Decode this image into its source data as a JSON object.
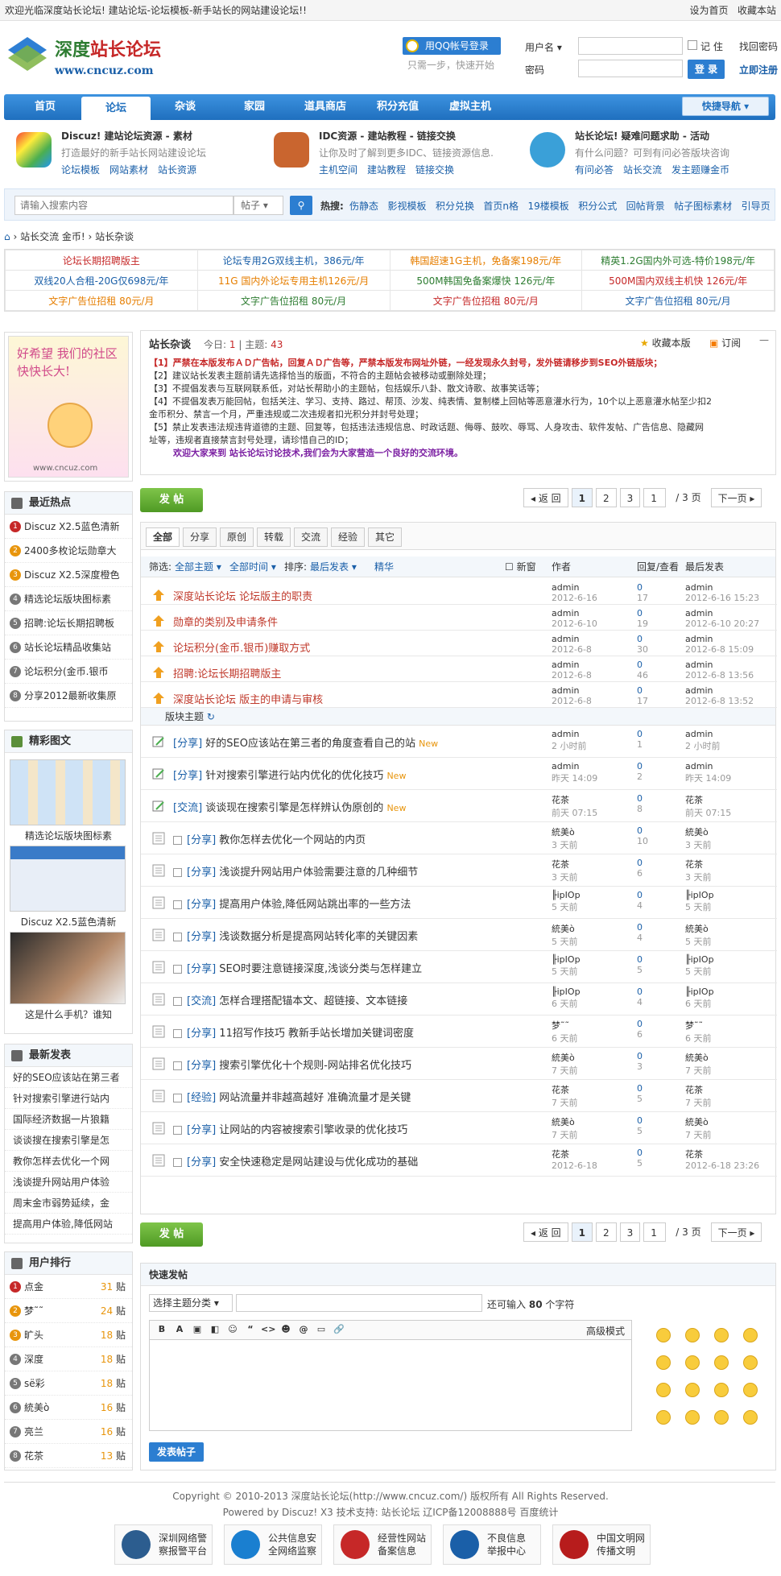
{
  "topbar": {
    "welcome": "欢迎光临深度站长论坛! 建站论坛-论坛模板-新手站长的网站建设论坛!!",
    "set_home": "设为首页",
    "bookmark": "收藏本站"
  },
  "logo": {
    "cn_a": "深度",
    "cn_b": "站长论坛",
    "url": "www.cncuz.com"
  },
  "login": {
    "qq_btn": "用QQ帐号登录",
    "qq_sub": "只需一步，快速开始",
    "username_label": "用户名",
    "password_label": "密码",
    "remember": "记 住",
    "forgot": "找回密码",
    "login_btn": "登 录",
    "register": "立即注册"
  },
  "nav": {
    "items": [
      "首页",
      "论坛",
      "杂谈",
      "家园",
      "道具商店",
      "积分充值",
      "虚拟主机"
    ],
    "quick": "快捷导航"
  },
  "features": [
    {
      "title": "Discuz! 建站论坛资源 - 素材",
      "desc": "打造最好的新手站长网站建设论坛",
      "links": "论坛模板　网站素材　站长资源"
    },
    {
      "title": "IDC资源 - 建站教程 - 链接交换",
      "desc": "让你及时了解到更多IDC、链接资源信息.",
      "links": "主机空间　建站教程　链接交换"
    },
    {
      "title": "站长论坛! 疑难问题求助 - 活动",
      "desc": "有什么问题？可到有问必答版块咨询",
      "links": "有问必答　站长交流　发主题赚金币"
    }
  ],
  "search": {
    "placeholder": "请输入搜索内容",
    "type": "帖子",
    "hot_label": "热搜:",
    "hot": [
      "伤静态",
      "影视模板",
      "积分兑换",
      "首页n格",
      "19楼模板",
      "积分公式",
      "回帖背景",
      "帖子图标素材",
      "引导页"
    ]
  },
  "breadcrumb": {
    "a": "站长交流 金币!",
    "b": "站长杂谈"
  },
  "ads": [
    [
      "论坛长期招聘版主",
      "论坛专用2G双线主机，386元/年",
      "韩国超速1G主机，免备案198元/年",
      "精英1.2G国内外可选-特价198元/年"
    ],
    [
      "双线20人合租-20G仅698元/年",
      "11G 国内外论坛专用主机126元/月",
      "500M韩国免备案爆快 126元/年",
      "500M国内双线主机快 126元/年"
    ],
    [
      "文字广告位招租 80元/月",
      "文字广告位招租 80元/月",
      "文字广告位招租 80元/月",
      "文字广告位招租 80元/月"
    ]
  ],
  "ad_colors": [
    "#c62828",
    "#1a5fa8",
    "#e67e00",
    "#2e7d32"
  ],
  "side": {
    "banner_text": "好希望 我们的社区 快快长大!",
    "banner_url": "www.cncuz.com",
    "hot_title": "最近热点",
    "hot": [
      "Discuz X2.5蓝色清新",
      "2400多枚论坛勋章大",
      "Discuz X2.5深度橙色",
      "精选论坛版块图标素",
      "招聘:论坛长期招聘板",
      "站长论坛精品收集站",
      "论坛积分(金币.银币",
      "分享2012最新收集原"
    ],
    "pic_title": "精彩图文",
    "pics": [
      "精选论坛版块图标素",
      "Discuz X2.5蓝色清新",
      "这是什么手机？谁知"
    ],
    "new_title": "最新发表",
    "new": [
      "好的SEO应该站在第三者",
      "针对搜索引擎进行站内",
      "国际经济数据一片狼籍",
      "谈谈搜在搜索引擎是怎",
      "教你怎样去优化一个网",
      "浅谈提升网站用户体验",
      "周末金市弱势延续，金",
      "提高用户体验,降低网站"
    ],
    "rank_title": "用户排行",
    "rank": [
      [
        "点金",
        "31"
      ],
      [
        "梦˜˜",
        "24"
      ],
      [
        "旷头",
        "18"
      ],
      [
        "深度",
        "18"
      ],
      [
        "sё彩",
        "18"
      ],
      [
        "統美ò",
        "16"
      ],
      [
        "亮兰",
        "16"
      ],
      [
        "花茶",
        "13"
      ]
    ],
    "rank_unit": "贴"
  },
  "forum": {
    "name": "站长杂谈",
    "today_label": "今日:",
    "today": "1",
    "topics_label": "主题:",
    "topics": "43",
    "fav": "收藏本版",
    "rss": "订阅",
    "rules": [
      "【1】严禁在本版发布ＡＤ广告帖，回复ＡＤ广告等，严禁本版发布网址外链，一经发现永久封号，发外链请移步到SEO外链版块；",
      "【2】建议站长发表主题前请先选择恰当的版面，不符合的主题帖会被移动或删除处理；",
      "【3】不提倡发表与互联网联系低，对站长帮助小的主题帖，包括娱乐八卦、散文诗歌、故事笑话等；",
      "【4】不提倡发表万能回帖，包括关注、学习、支持、路过、帮顶、沙发、纯表情、复制楼上回帖等恶意灌水行为，10个以上恶意灌水帖至少扣2",
      "金币积分、禁言一个月，严重违规或二次违规者扣光积分并封号处理；",
      "【5】禁止发表违法规违背道德的主题、回复等，包括违法违规信息、时政话题、侮辱、鼓吹、辱骂、人身攻击、软件发帖、广告信息、隐藏网",
      "址等，违规者直接禁言封号处理，请珍惜自己的ID；"
    ],
    "welcome": "欢迎大家来到 站长论坛讨论技术,我们会为大家营造一个良好的交流环境。"
  },
  "post_btn": "发 帖",
  "pager": {
    "back": "◂ 返 回",
    "p1": "1",
    "p2": "2",
    "p3": "3",
    "cur": "1",
    "total": "/ 3 页",
    "next": "下一页 ▸"
  },
  "tabs": [
    "全部",
    "分享",
    "原创",
    "转载",
    "交流",
    "经验",
    "其它"
  ],
  "filter": {
    "label": "筛选:",
    "all": "全部主题",
    "time": "全部时间",
    "sort_label": "排序:",
    "sort": "最后发表",
    "digest": "精华",
    "new_win": "新窗",
    "col_author": "作者",
    "col_reply": "回复/查看",
    "col_last": "最后发表"
  },
  "sticky_label": "版块主题",
  "threads": [
    {
      "type": "sticky",
      "tag": "",
      "title": "深度站长论坛 论坛版主的职责",
      "author": "admin",
      "date": "2012-6-16",
      "r": "0",
      "v": "17",
      "lu": "admin",
      "ld": "2012-6-16 15:23"
    },
    {
      "type": "sticky",
      "tag": "",
      "title": "勋章的类别及申请条件",
      "author": "admin",
      "date": "2012-6-10",
      "r": "0",
      "v": "19",
      "lu": "admin",
      "ld": "2012-6-10 20:27"
    },
    {
      "type": "sticky",
      "tag": "",
      "title": "论坛积分(金币.银币)赚取方式",
      "author": "admin",
      "date": "2012-6-8",
      "r": "0",
      "v": "30",
      "lu": "admin",
      "ld": "2012-6-8 15:09"
    },
    {
      "type": "sticky",
      "tag": "",
      "title": "招聘:论坛长期招聘版主",
      "author": "admin",
      "date": "2012-6-8",
      "r": "0",
      "v": "46",
      "lu": "admin",
      "ld": "2012-6-8 13:56"
    },
    {
      "type": "sticky",
      "tag": "",
      "title": "深度站长论坛 版主的申请与审核",
      "author": "admin",
      "date": "2012-6-8",
      "r": "0",
      "v": "17",
      "lu": "admin",
      "ld": "2012-6-8 13:52"
    },
    {
      "type": "new",
      "tag": "[分享]",
      "title": "好的SEO应该站在第三者的角度查看自己的站",
      "author": "admin",
      "date": "2 小时前",
      "r": "0",
      "v": "1",
      "lu": "admin",
      "ld": "2 小时前"
    },
    {
      "type": "new",
      "tag": "[分享]",
      "title": "针对搜索引擎进行站内优化的优化技巧",
      "author": "admin",
      "date": "昨天 14:09",
      "r": "0",
      "v": "2",
      "lu": "admin",
      "ld": "昨天 14:09"
    },
    {
      "type": "new",
      "tag": "[交流]",
      "title": "谈谈现在搜索引擎是怎样辨认伪原创的",
      "author": "花茶",
      "date": "前天 07:15",
      "r": "0",
      "v": "8",
      "lu": "花茶",
      "ld": "前天 07:15"
    },
    {
      "type": "normal",
      "tag": "[分享]",
      "title": "教你怎样去优化一个网站的内页",
      "author": "統美ò",
      "date": "3 天前",
      "r": "0",
      "v": "10",
      "lu": "統美ò",
      "ld": "3 天前"
    },
    {
      "type": "normal",
      "tag": "[分享]",
      "title": "浅谈提升网站用户体验需要注意的几种细节",
      "author": "花茶",
      "date": "3 天前",
      "r": "0",
      "v": "6",
      "lu": "花茶",
      "ld": "3 天前"
    },
    {
      "type": "normal",
      "tag": "[分享]",
      "title": "提高用户体验,降低网站跳出率的一些方法",
      "author": "╟ipIOp",
      "date": "5 天前",
      "r": "0",
      "v": "4",
      "lu": "╟ipIOp",
      "ld": "5 天前"
    },
    {
      "type": "normal",
      "tag": "[分享]",
      "title": "浅谈数据分析是提高网站转化率的关键因素",
      "author": "統美ò",
      "date": "5 天前",
      "r": "0",
      "v": "4",
      "lu": "統美ò",
      "ld": "5 天前"
    },
    {
      "type": "normal",
      "tag": "[分享]",
      "title": "SEO时要注意链接深度,浅谈分类与怎样建立",
      "author": "╟ipIOp",
      "date": "5 天前",
      "r": "0",
      "v": "5",
      "lu": "╟ipIOp",
      "ld": "5 天前"
    },
    {
      "type": "normal",
      "tag": "[交流]",
      "title": "怎样合理搭配锚本文、超链接、文本链接",
      "author": "╟ipIOp",
      "date": "6 天前",
      "r": "0",
      "v": "4",
      "lu": "╟ipIOp",
      "ld": "6 天前"
    },
    {
      "type": "normal",
      "tag": "[分享]",
      "title": "11招写作技巧 教新手站长增加关键词密度",
      "author": "梦˜˜",
      "date": "6 天前",
      "r": "0",
      "v": "6",
      "lu": "梦˜˜",
      "ld": "6 天前"
    },
    {
      "type": "normal",
      "tag": "[分享]",
      "title": "搜索引擎优化十个规则-网站排名优化技巧",
      "author": "統美ò",
      "date": "7 天前",
      "r": "0",
      "v": "3",
      "lu": "統美ò",
      "ld": "7 天前"
    },
    {
      "type": "normal",
      "tag": "[经验]",
      "title": "网站流量并非越高越好 准确流量才是关键",
      "author": "花茶",
      "date": "7 天前",
      "r": "0",
      "v": "5",
      "lu": "花茶",
      "ld": "7 天前"
    },
    {
      "type": "normal",
      "tag": "[分享]",
      "title": "让网站的内容被搜索引擎收录的优化技巧",
      "author": "統美ò",
      "date": "7 天前",
      "r": "0",
      "v": "5",
      "lu": "統美ò",
      "ld": "7 天前"
    },
    {
      "type": "normal",
      "tag": "[分享]",
      "title": "安全快速稳定是网站建设与优化成功的基础",
      "author": "花茶",
      "date": "2012-6-18",
      "r": "0",
      "v": "5",
      "lu": "花茶",
      "ld": "2012-6-18 23:26"
    }
  ],
  "quick": {
    "title": "快速发帖",
    "cat": "选择主题分类",
    "remain": "还可输入",
    "count": "80",
    "unit": "个字符",
    "adv": "高级模式",
    "submit": "发表帖子",
    "tools": [
      "B",
      "A",
      "▣",
      "◧",
      "☺",
      "“",
      "<>",
      "☻",
      "@",
      "▭",
      "🔗"
    ]
  },
  "footer": {
    "copy": "Copyright © 2010-2013 深度站长论坛(http://www.cncuz.com/) 版权所有 All Rights Reserved.",
    "powered": "Powered by Discuz! X3  技术支持: 站长论坛 辽ICP备12008888号 百度统计",
    "badges": [
      [
        "深圳网络警",
        "察报警平台"
      ],
      [
        "公共信息安",
        "全网络监察"
      ],
      [
        "经营性网站",
        "备案信息"
      ],
      [
        "不良信息",
        "举报中心"
      ],
      [
        "中国文明网",
        "传播文明"
      ]
    ]
  }
}
